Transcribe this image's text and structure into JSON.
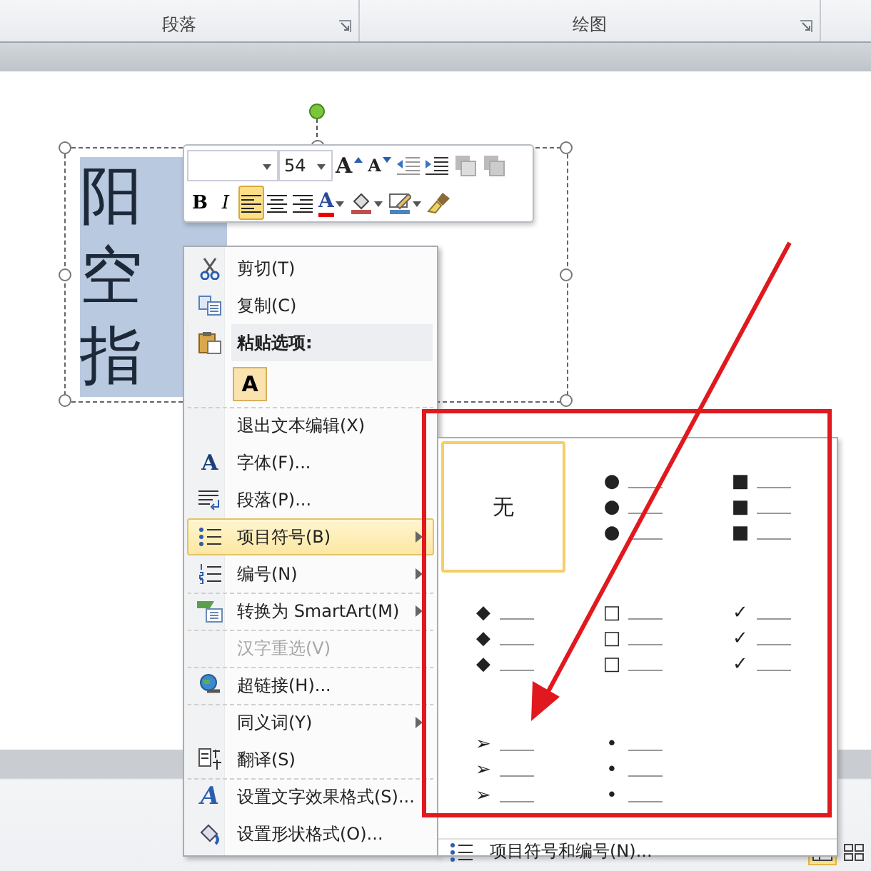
{
  "ribbon": {
    "groups": [
      {
        "label": "段落"
      },
      {
        "label": "绘图"
      }
    ]
  },
  "slide": {
    "textbox": {
      "selected": true,
      "lines": [
        "阳",
        "空",
        "指"
      ]
    }
  },
  "mini_toolbar": {
    "font_size": "54",
    "row1": [
      {
        "kind": "grow-font",
        "glyph": "A"
      },
      {
        "kind": "shrink-font",
        "glyph": "A"
      },
      {
        "kind": "decrease-indent"
      },
      {
        "kind": "increase-indent"
      },
      {
        "kind": "bring-forward"
      },
      {
        "kind": "send-backward"
      }
    ],
    "row2": [
      {
        "kind": "bold",
        "glyph": "B",
        "selected": false
      },
      {
        "kind": "italic",
        "glyph": "I",
        "selected": false
      },
      {
        "kind": "align-left",
        "selected": true
      },
      {
        "kind": "align-center",
        "selected": false
      },
      {
        "kind": "align-right",
        "selected": false
      },
      {
        "kind": "font-color",
        "glyph": "A",
        "selected": false
      },
      {
        "kind": "fill",
        "selected": false
      },
      {
        "kind": "outline",
        "selected": false
      },
      {
        "kind": "painter",
        "selected": false
      }
    ]
  },
  "context_menu": {
    "items": [
      {
        "kind": "cut",
        "label": "剪切(T)",
        "selected": false,
        "disabled": false,
        "submenu": false,
        "separated": false
      },
      {
        "kind": "copy",
        "label": "复制(C)",
        "selected": false,
        "disabled": false,
        "submenu": false,
        "separated": false
      },
      {
        "kind": "header",
        "label": "粘贴选项:"
      },
      {
        "kind": "paste-option",
        "glyph": "A"
      },
      {
        "kind": "exit-edit",
        "label": "退出文本编辑(X)",
        "selected": false,
        "disabled": false,
        "submenu": false,
        "separated": true
      },
      {
        "kind": "font",
        "glyph": "A",
        "label": "字体(F)...",
        "selected": false,
        "disabled": false,
        "submenu": false,
        "separated": false
      },
      {
        "kind": "paragraph",
        "label": "段落(P)...",
        "selected": false,
        "disabled": false,
        "submenu": false,
        "separated": false
      },
      {
        "kind": "bullets",
        "label": "项目符号(B)",
        "selected": true,
        "disabled": false,
        "submenu": true,
        "separated": false
      },
      {
        "kind": "numbering",
        "label": "编号(N)",
        "selected": false,
        "disabled": false,
        "submenu": true,
        "separated": false
      },
      {
        "kind": "smartart",
        "label": "转换为 SmartArt(M)",
        "selected": false,
        "disabled": false,
        "submenu": true,
        "separated": true
      },
      {
        "kind": "reselect",
        "label": "汉字重选(V)",
        "selected": false,
        "disabled": true,
        "submenu": false,
        "separated": true
      },
      {
        "kind": "hyperlink",
        "label": "超链接(H)...",
        "selected": false,
        "disabled": false,
        "submenu": false,
        "separated": true
      },
      {
        "kind": "synonyms",
        "label": "同义词(Y)",
        "selected": false,
        "disabled": false,
        "submenu": true,
        "separated": true
      },
      {
        "kind": "translate",
        "label": "翻译(S)",
        "selected": false,
        "disabled": false,
        "submenu": false,
        "separated": false
      },
      {
        "kind": "text-effects",
        "glyph": "A",
        "label": "设置文字效果格式(S)...",
        "selected": false,
        "disabled": false,
        "submenu": false,
        "separated": true
      },
      {
        "kind": "shape-format",
        "label": "设置形状格式(O)...",
        "selected": false,
        "disabled": false,
        "submenu": false,
        "separated": false
      }
    ]
  },
  "bullet_gallery": {
    "cells": [
      {
        "kind": "none",
        "label": "无",
        "selected": true
      },
      {
        "kind": "bullets",
        "bullet": "●",
        "selected": false
      },
      {
        "kind": "bullets",
        "bullet": "■",
        "selected": false
      },
      {
        "kind": "bullets",
        "bullet": "◆",
        "selected": false
      },
      {
        "kind": "bullets",
        "bullet": "□",
        "selected": false
      },
      {
        "kind": "bullets",
        "bullet": "✓",
        "selected": false
      },
      {
        "kind": "bullets",
        "bullet": "➢",
        "selected": false
      },
      {
        "kind": "bullets",
        "bullet": "•",
        "selected": false
      }
    ],
    "footer": {
      "label": "项目符号和编号(N)..."
    }
  },
  "status_bar": {
    "views": [
      {
        "selected": true
      },
      {
        "selected": false
      }
    ]
  }
}
